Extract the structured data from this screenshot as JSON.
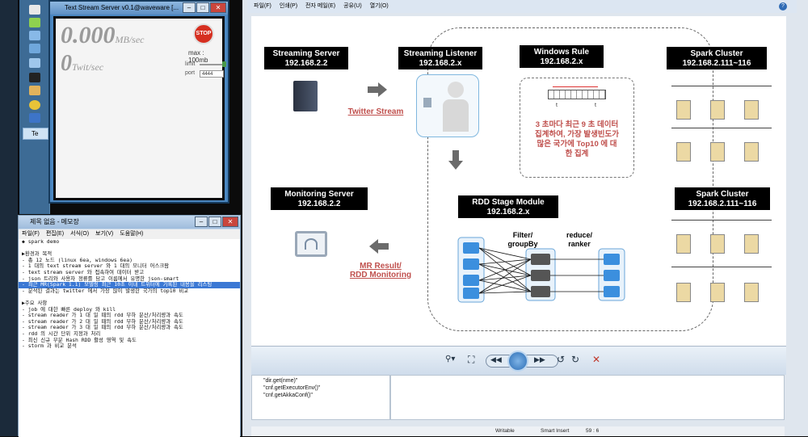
{
  "stream_server": {
    "title": "Text Stream Server v0.1@waveware [...",
    "mb_value": "0.000",
    "mb_unit": "MB/sec",
    "twit_value": "0",
    "twit_unit": "Twit/sec",
    "stop_label": "STOP",
    "max_label": "max : 100mb",
    "limit_label": "limit",
    "port_label": "port",
    "port_value": "4444"
  },
  "taskbar": {
    "active_label": "Te"
  },
  "notepad": {
    "title": "제목 없음 - 메모장",
    "menu": [
      "파일(F)",
      "편집(E)",
      "서식(O)",
      "보기(V)",
      "도움말(H)"
    ],
    "lines": [
      "◆ spark demo",
      "",
      "▶환경과 목적",
      " - 총 12 노드 (linux 6ea, windows 6ea)",
      " - 1 대의 text stream server 와 1 대의 모니터 어스크팜",
      " - text stream server 와 접속하여 데이터 받고",
      " - json 트리와 사용자 정류를 담고 이름에서 유명한 json-smart",
      " - 최근 MR(Spark 1.1) 모델링 최근 10초 이내 트위터에 기록된 내용을 리스팅",
      " - 분석된 결과는 twitter 에서 가장 많이 발생한 국가의 top10 비교",
      "",
      "▶주요 사항",
      " - job 에 대한 빠른 deploy 와 kill",
      " - stream reader 가 1 대 일 때의 rdd 부하 분산/처리량과 속도",
      " - stream reader 가 2 대 일 때의 rdd 부하 분산/처리량과 속도",
      " - stream reader 가 3 대 일 때의 rdd 부하 분산/처리량과 속도",
      " - rdd 의 시간 단위 지정과 처리",
      " - 최신 신규 부분 Hash RDD 활성 영역 및 속도",
      " - storm 과 비교 분석"
    ],
    "selected_index": 7
  },
  "eclipse": {
    "menu": [
      "파일(F)",
      "인쇄(P)",
      "전자 메일(E)",
      "공유(U)",
      "열기(O)"
    ],
    "code_lines": [
      "\"dir.get(nme)\"",
      "\"cnf.getExecutorEnv()\"",
      "\"cnf.getAkkaConf()\""
    ],
    "status": {
      "writable": "Writable",
      "insert": "Smart Insert",
      "position": "59 : 6"
    }
  },
  "slide": {
    "streaming_server": {
      "title": "Streaming Server",
      "ip": "192.168.2.2"
    },
    "streaming_listener": {
      "title": "Streaming Listener",
      "ip": "192.168.2.x"
    },
    "windows_rule": {
      "title": "Windows Rule",
      "ip": "192.168.2.x"
    },
    "spark_cluster_1": {
      "title": "Spark Cluster",
      "ip": "192.168.2.111~116"
    },
    "spark_cluster_2": {
      "title": "Spark Cluster",
      "ip": "192.168.2.111~116"
    },
    "monitoring_server": {
      "title": "Monitoring Server",
      "ip": "192.168.2.2"
    },
    "rdd_stage": {
      "title": "RDD Stage Module",
      "ip": "192.168.2.x"
    },
    "twitter_stream": "Twitter Stream",
    "mr_result": "MR Result/",
    "rdd_monitoring": "RDD Monitoring",
    "rule_text_1": "3 초마다 최근 9 초 데이터",
    "rule_text_2": "집계하여, 가장 발생빈도가",
    "rule_text_3": "많은 국가에  Top10 에 대",
    "rule_text_4": "한 집계",
    "filter_label": "Filter/",
    "groupby_label": "groupBy",
    "reduce_label": "reduce/",
    "ranker_label": "ranker",
    "t1_label": "t",
    "t2_label": "t"
  }
}
